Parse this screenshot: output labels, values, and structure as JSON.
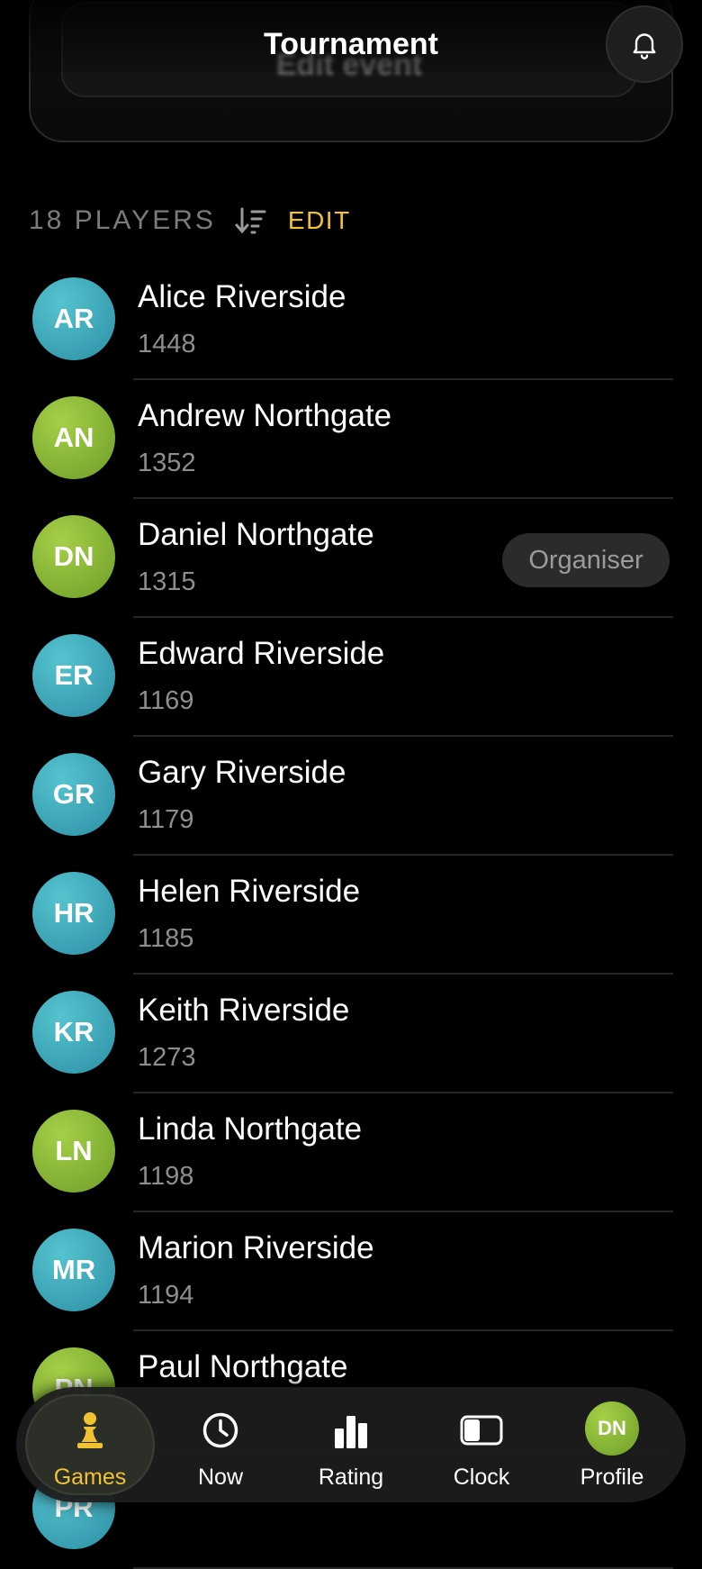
{
  "header": {
    "title": "Tournament",
    "edit_event_label": "Edit event",
    "bell_icon": "bell-icon"
  },
  "section": {
    "players_count": "18 PLAYERS",
    "sort_icon": "sort-descending-icon",
    "edit_label": "EDIT"
  },
  "players": [
    {
      "initials": "AR",
      "name": "Alice Riverside",
      "rating": "1448",
      "color": "teal"
    },
    {
      "initials": "AN",
      "name": "Andrew Northgate",
      "rating": "1352",
      "color": "green"
    },
    {
      "initials": "DN",
      "name": "Daniel Northgate",
      "rating": "1315",
      "color": "green",
      "badge": "Organiser"
    },
    {
      "initials": "ER",
      "name": "Edward Riverside",
      "rating": "1169",
      "color": "teal"
    },
    {
      "initials": "GR",
      "name": "Gary Riverside",
      "rating": "1179",
      "color": "teal"
    },
    {
      "initials": "HR",
      "name": "Helen Riverside",
      "rating": "1185",
      "color": "teal"
    },
    {
      "initials": "KR",
      "name": "Keith Riverside",
      "rating": "1273",
      "color": "teal"
    },
    {
      "initials": "LN",
      "name": "Linda Northgate",
      "rating": "1198",
      "color": "green"
    },
    {
      "initials": "MR",
      "name": "Marion Riverside",
      "rating": "1194",
      "color": "teal"
    },
    {
      "initials": "PN",
      "name": "Paul Northgate",
      "rating": "",
      "color": "green"
    },
    {
      "initials": "PR",
      "name": "",
      "rating": "",
      "color": "teal"
    }
  ],
  "tabs": [
    {
      "label": "Games",
      "icon": "pawn-icon",
      "active": true
    },
    {
      "label": "Now",
      "icon": "clock-icon",
      "active": false
    },
    {
      "label": "Rating",
      "icon": "bar-chart-icon",
      "active": false
    },
    {
      "label": "Clock",
      "icon": "chess-clock-icon",
      "active": false
    },
    {
      "label": "Profile",
      "icon": "avatar",
      "initials": "DN",
      "active": false
    }
  ],
  "colors": {
    "accent": "#f1c232",
    "avatar_teal": "#3aa6b8",
    "avatar_green": "#8ab83a",
    "background": "#000000"
  }
}
